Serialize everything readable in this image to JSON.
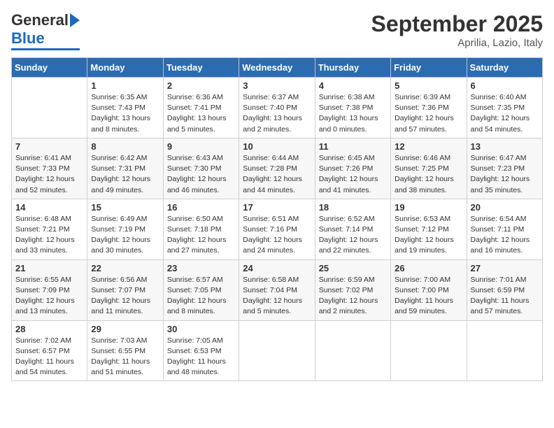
{
  "header": {
    "logo_general": "General",
    "logo_blue": "Blue",
    "month_title": "September 2025",
    "location": "Aprilia, Lazio, Italy"
  },
  "days_of_week": [
    "Sunday",
    "Monday",
    "Tuesday",
    "Wednesday",
    "Thursday",
    "Friday",
    "Saturday"
  ],
  "weeks": [
    [
      null,
      {
        "day": 1,
        "sunrise": "6:35 AM",
        "sunset": "7:43 PM",
        "daylight": "13 hours and 8 minutes."
      },
      {
        "day": 2,
        "sunrise": "6:36 AM",
        "sunset": "7:41 PM",
        "daylight": "13 hours and 5 minutes."
      },
      {
        "day": 3,
        "sunrise": "6:37 AM",
        "sunset": "7:40 PM",
        "daylight": "13 hours and 2 minutes."
      },
      {
        "day": 4,
        "sunrise": "6:38 AM",
        "sunset": "7:38 PM",
        "daylight": "13 hours and 0 minutes."
      },
      {
        "day": 5,
        "sunrise": "6:39 AM",
        "sunset": "7:36 PM",
        "daylight": "12 hours and 57 minutes."
      },
      {
        "day": 6,
        "sunrise": "6:40 AM",
        "sunset": "7:35 PM",
        "daylight": "12 hours and 54 minutes."
      }
    ],
    [
      {
        "day": 7,
        "sunrise": "6:41 AM",
        "sunset": "7:33 PM",
        "daylight": "12 hours and 52 minutes."
      },
      {
        "day": 8,
        "sunrise": "6:42 AM",
        "sunset": "7:31 PM",
        "daylight": "12 hours and 49 minutes."
      },
      {
        "day": 9,
        "sunrise": "6:43 AM",
        "sunset": "7:30 PM",
        "daylight": "12 hours and 46 minutes."
      },
      {
        "day": 10,
        "sunrise": "6:44 AM",
        "sunset": "7:28 PM",
        "daylight": "12 hours and 44 minutes."
      },
      {
        "day": 11,
        "sunrise": "6:45 AM",
        "sunset": "7:26 PM",
        "daylight": "12 hours and 41 minutes."
      },
      {
        "day": 12,
        "sunrise": "6:46 AM",
        "sunset": "7:25 PM",
        "daylight": "12 hours and 38 minutes."
      },
      {
        "day": 13,
        "sunrise": "6:47 AM",
        "sunset": "7:23 PM",
        "daylight": "12 hours and 35 minutes."
      }
    ],
    [
      {
        "day": 14,
        "sunrise": "6:48 AM",
        "sunset": "7:21 PM",
        "daylight": "12 hours and 33 minutes."
      },
      {
        "day": 15,
        "sunrise": "6:49 AM",
        "sunset": "7:19 PM",
        "daylight": "12 hours and 30 minutes."
      },
      {
        "day": 16,
        "sunrise": "6:50 AM",
        "sunset": "7:18 PM",
        "daylight": "12 hours and 27 minutes."
      },
      {
        "day": 17,
        "sunrise": "6:51 AM",
        "sunset": "7:16 PM",
        "daylight": "12 hours and 24 minutes."
      },
      {
        "day": 18,
        "sunrise": "6:52 AM",
        "sunset": "7:14 PM",
        "daylight": "12 hours and 22 minutes."
      },
      {
        "day": 19,
        "sunrise": "6:53 AM",
        "sunset": "7:12 PM",
        "daylight": "12 hours and 19 minutes."
      },
      {
        "day": 20,
        "sunrise": "6:54 AM",
        "sunset": "7:11 PM",
        "daylight": "12 hours and 16 minutes."
      }
    ],
    [
      {
        "day": 21,
        "sunrise": "6:55 AM",
        "sunset": "7:09 PM",
        "daylight": "12 hours and 13 minutes."
      },
      {
        "day": 22,
        "sunrise": "6:56 AM",
        "sunset": "7:07 PM",
        "daylight": "12 hours and 11 minutes."
      },
      {
        "day": 23,
        "sunrise": "6:57 AM",
        "sunset": "7:05 PM",
        "daylight": "12 hours and 8 minutes."
      },
      {
        "day": 24,
        "sunrise": "6:58 AM",
        "sunset": "7:04 PM",
        "daylight": "12 hours and 5 minutes."
      },
      {
        "day": 25,
        "sunrise": "6:59 AM",
        "sunset": "7:02 PM",
        "daylight": "12 hours and 2 minutes."
      },
      {
        "day": 26,
        "sunrise": "7:00 AM",
        "sunset": "7:00 PM",
        "daylight": "11 hours and 59 minutes."
      },
      {
        "day": 27,
        "sunrise": "7:01 AM",
        "sunset": "6:59 PM",
        "daylight": "11 hours and 57 minutes."
      }
    ],
    [
      {
        "day": 28,
        "sunrise": "7:02 AM",
        "sunset": "6:57 PM",
        "daylight": "11 hours and 54 minutes."
      },
      {
        "day": 29,
        "sunrise": "7:03 AM",
        "sunset": "6:55 PM",
        "daylight": "11 hours and 51 minutes."
      },
      {
        "day": 30,
        "sunrise": "7:05 AM",
        "sunset": "6:53 PM",
        "daylight": "11 hours and 48 minutes."
      },
      null,
      null,
      null,
      null
    ]
  ]
}
